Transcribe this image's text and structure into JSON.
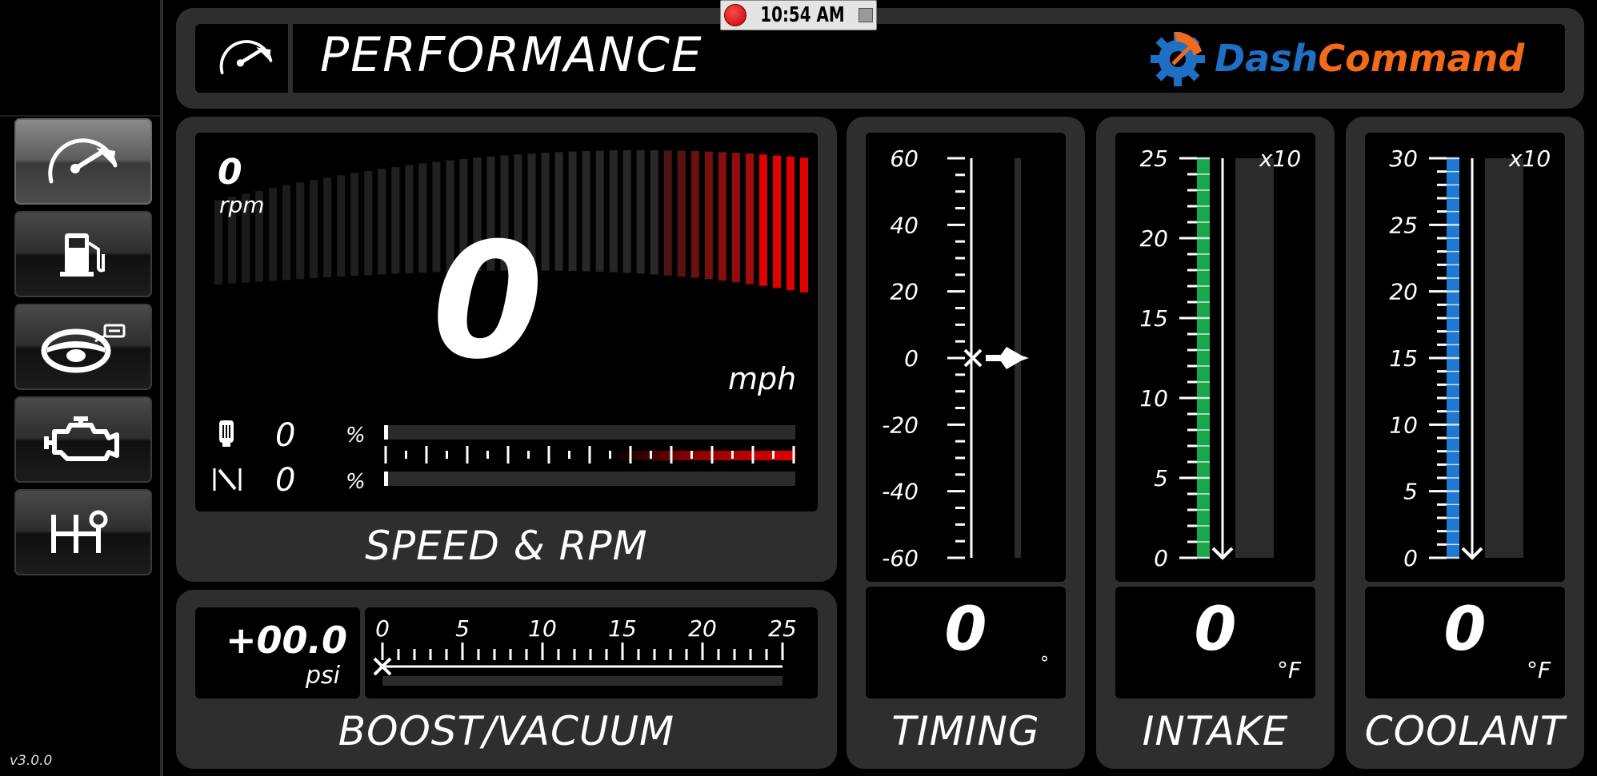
{
  "app": {
    "version": "v3.0.0"
  },
  "clock": {
    "time": "10:54 AM"
  },
  "header": {
    "title": "PERFORMANCE",
    "logo_part1": "Dash",
    "logo_part2": "Command",
    "logo_colors": {
      "dash": "#1f6fc4",
      "command": "#f26a1b"
    }
  },
  "sidebar": {
    "items": [
      {
        "icon": "speedometer-icon",
        "active": true
      },
      {
        "icon": "fuel-pump-icon",
        "active": false
      },
      {
        "icon": "steering-wheel-icon",
        "active": false
      },
      {
        "icon": "engine-icon",
        "active": false
      },
      {
        "icon": "gear-shifter-icon",
        "active": false
      }
    ]
  },
  "speed_rpm": {
    "title": "SPEED & RPM",
    "rpm_value": "0",
    "rpm_unit": "rpm",
    "speed_value": "0",
    "speed_unit": "mph",
    "throttle_value": "0",
    "throttle_unit": "%",
    "load_value": "0",
    "load_unit": "%",
    "redline_color": "#e00000"
  },
  "boost": {
    "title": "BOOST/VACUUM",
    "value": "+00.0",
    "unit": "psi",
    "scale": [
      "0",
      "5",
      "10",
      "15",
      "20",
      "25"
    ]
  },
  "timing": {
    "title": "TIMING",
    "value": "0",
    "unit": "°",
    "scale": [
      "60",
      "40",
      "20",
      "0",
      "-20",
      "-40",
      "-60"
    ]
  },
  "intake": {
    "title": "INTAKE",
    "value": "0",
    "unit": "°F",
    "multiplier": "x10",
    "scale": [
      "25",
      "20",
      "15",
      "10",
      "5",
      "0"
    ],
    "bar_color": "#1aa64b"
  },
  "coolant": {
    "title": "COOLANT",
    "value": "0",
    "unit": "°F",
    "multiplier": "x10",
    "scale": [
      "30",
      "25",
      "20",
      "15",
      "10",
      "5",
      "0"
    ],
    "bar_color": "#1f78d1"
  }
}
